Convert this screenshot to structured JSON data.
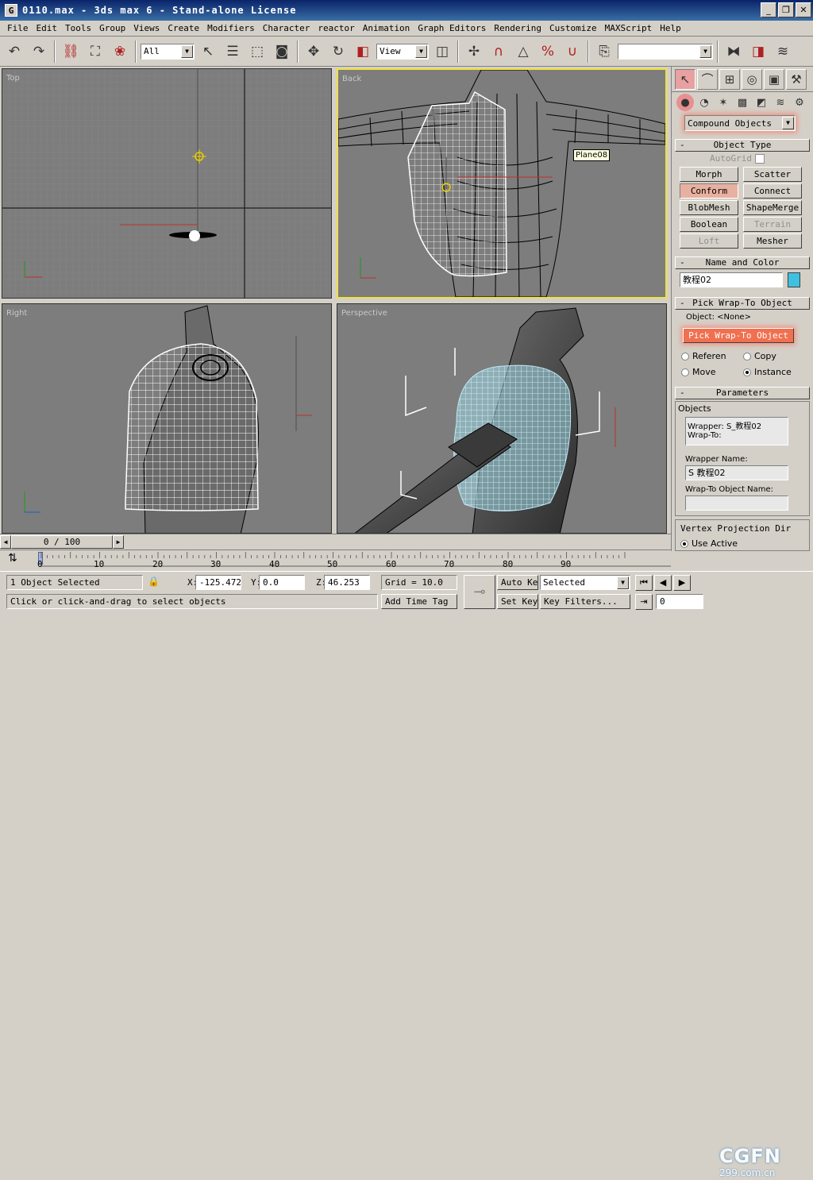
{
  "window": {
    "title": "0110.max - 3ds max 6 - Stand-alone License",
    "app_icon": "G"
  },
  "menu": [
    "File",
    "Edit",
    "Tools",
    "Group",
    "Views",
    "Create",
    "Modifiers",
    "Character",
    "reactor",
    "Animation",
    "Graph Editors",
    "Rendering",
    "Customize",
    "MAXScript",
    "Help"
  ],
  "toolbar": {
    "selection_filter": "All",
    "ref_coord": "View"
  },
  "viewports": {
    "top": {
      "label": "Top"
    },
    "back": {
      "label": "Back",
      "tooltip": "Plane08"
    },
    "right": {
      "label": "Right"
    },
    "perspective": {
      "label": "Perspective"
    }
  },
  "cmd": {
    "category": "Compound Objects",
    "object_type": {
      "header": "Object Type",
      "autogrid": "AutoGrid",
      "buttons": [
        "Morph",
        "Scatter",
        "Conform",
        "Connect",
        "BlobMesh",
        "ShapeMerge",
        "Boolean",
        "Terrain",
        "Loft",
        "Mesher"
      ]
    },
    "name_color": {
      "header": "Name and Color",
      "name": "教程02",
      "color": "#40c0e0"
    },
    "pick": {
      "header": "Pick Wrap-To Object",
      "object_label": "Object: <None>",
      "button": "Pick Wrap-To Object",
      "radios": [
        "Referen",
        "Copy",
        "Move",
        "Instance"
      ]
    },
    "params": {
      "header": "Parameters",
      "objects_label": "Objects",
      "list": [
        "Wrapper: S_教程02",
        "Wrap-To:"
      ],
      "wrapper_name_label": "Wrapper Name:",
      "wrapper_name": "S 教程02",
      "wrapto_label": "Wrap-To Object Name:",
      "vp_label": "Vertex Projection Dir",
      "use_active": "Use Active"
    }
  },
  "time": {
    "frame": "0 / 100",
    "ticks": [
      "0",
      "10",
      "20",
      "30",
      "40",
      "50",
      "60",
      "70",
      "80",
      "90"
    ]
  },
  "status": {
    "selected": "1 Object Selected",
    "prompt": "Click or click-and-drag to select objects",
    "x_label": "X:",
    "x": "-125.472",
    "y_label": "Y:",
    "y": "0.0",
    "z_label": "Z:",
    "z": "46.253",
    "grid": "Grid = 10.0",
    "add_time_tag": "Add Time Tag",
    "auto_key": "Auto Key",
    "set_key": "Set Key",
    "key_mode": "Selected",
    "key_filters": "Key Filters...",
    "frame_field": "0"
  },
  "watermark": {
    "brand": "CGFN",
    "url": "299.com.cn"
  }
}
